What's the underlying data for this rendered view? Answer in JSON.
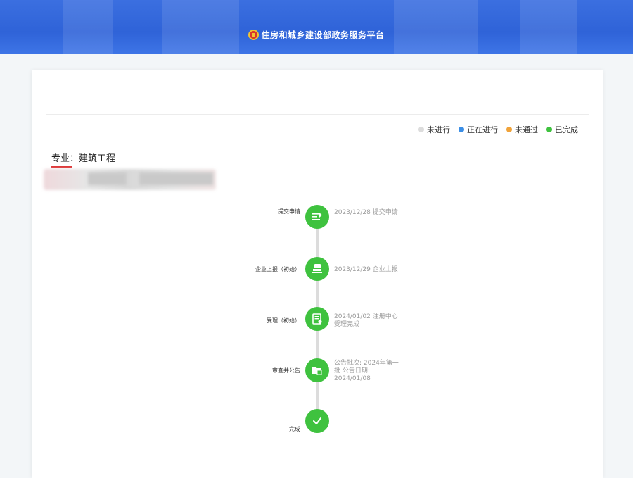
{
  "header": {
    "title": "住房和城乡建设部政务服务平台",
    "colors": {
      "background": "#2f63d8",
      "text": "#ffffff"
    },
    "emblem_icon": "national-emblem-icon"
  },
  "legend": {
    "items": [
      {
        "label": "未进行",
        "color": "#dcdcdc"
      },
      {
        "label": "正在进行",
        "color": "#3a8ee6"
      },
      {
        "label": "未通过",
        "color": "#f0a33a"
      },
      {
        "label": "已完成",
        "color": "#3fc23f"
      }
    ]
  },
  "profile": {
    "major": "专业：建筑工程"
  },
  "timeline": {
    "steps": [
      {
        "label": "提交申请",
        "desc": "2023/12/28 提交申请",
        "icon": "submit-list-icon",
        "status": "已完成"
      },
      {
        "label": "企业上报（初始）",
        "desc": "2023/12/29 企业上报",
        "icon": "stamp-report-icon",
        "status": "已完成"
      },
      {
        "label": "受理（初始）",
        "desc": "2024/01/02 注册中心受理完成",
        "icon": "document-accept-icon",
        "status": "已完成"
      },
      {
        "label": "审查并公告",
        "desc": "公告批次: 2024年第一批 公告日期: 2024/01/08",
        "icon": "folder-announce-icon",
        "status": "已完成"
      },
      {
        "label": "完成",
        "desc": "",
        "icon": "check-icon",
        "status": "已完成"
      }
    ]
  }
}
